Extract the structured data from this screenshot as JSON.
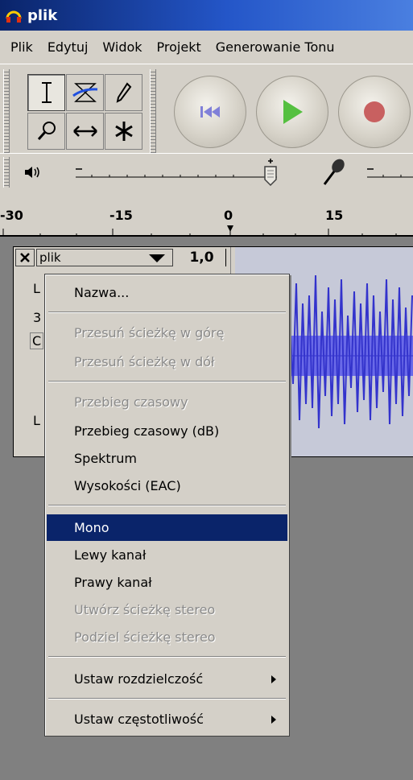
{
  "window": {
    "title": "plik"
  },
  "menubar": {
    "items": [
      "Plik",
      "Edytuj",
      "Widok",
      "Projekt",
      "Generowanie Tonu"
    ]
  },
  "ruler": {
    "labels": [
      "-30",
      "-15",
      "0",
      "15"
    ]
  },
  "track": {
    "name": "plik",
    "gain": "1,0",
    "clip_letters": [
      "L",
      "3",
      "C",
      "L"
    ]
  },
  "context_menu": {
    "items": [
      {
        "label": "Nazwa...",
        "state": "enabled"
      },
      {
        "label": "Przesuń ścieżkę w górę",
        "state": "disabled"
      },
      {
        "label": "Przesuń ścieżkę w dół",
        "state": "disabled"
      },
      {
        "label": "Przebieg czasowy",
        "state": "disabled"
      },
      {
        "label": "Przebieg czasowy (dB)",
        "state": "enabled"
      },
      {
        "label": "Spektrum",
        "state": "enabled"
      },
      {
        "label": "Wysokości (EAC)",
        "state": "enabled"
      },
      {
        "label": "Mono",
        "state": "selected"
      },
      {
        "label": "Lewy kanał",
        "state": "enabled"
      },
      {
        "label": "Prawy kanał",
        "state": "enabled"
      },
      {
        "label": "Utwórz ścieżkę stereo",
        "state": "disabled"
      },
      {
        "label": "Podziel ścieżkę stereo",
        "state": "disabled"
      },
      {
        "label": "Ustaw rozdzielczość",
        "state": "enabled",
        "submenu": true
      },
      {
        "label": "Ustaw częstotliwość",
        "state": "enabled",
        "submenu": true
      }
    ]
  },
  "colors": {
    "title_blue": "#0a246a",
    "selection": "#0a246a",
    "waveform": "#3333cc",
    "play_green": "#55c040",
    "record_red": "#c86060",
    "rewind_purple": "#8080d8"
  }
}
